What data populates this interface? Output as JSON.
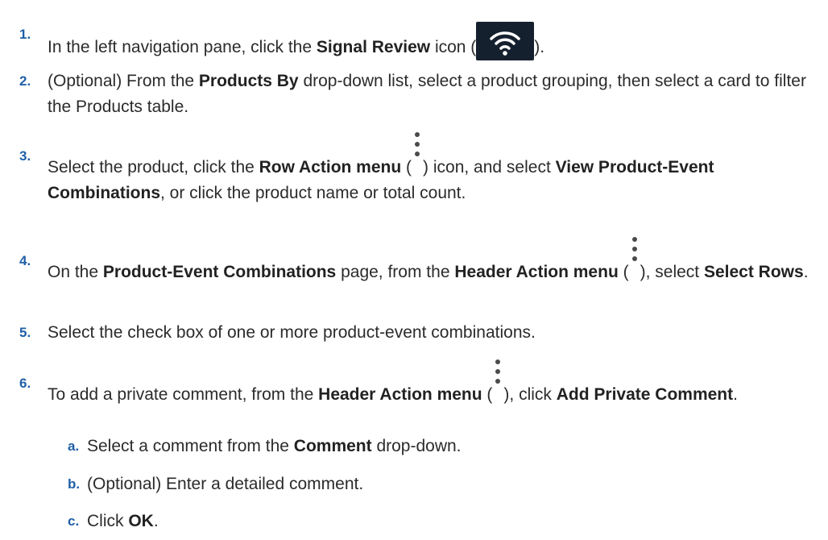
{
  "steps": [
    {
      "num": "1.",
      "parts": {
        "a": "In the left navigation pane, click the ",
        "b": "Signal Review",
        "c": " icon (",
        "d": ")."
      },
      "icon": "wifi-icon"
    },
    {
      "num": "2.",
      "parts": {
        "a": "(Optional) From the ",
        "b": "Products By",
        "c": " drop-down list, select a product grouping, then select a card to filter the Products table."
      }
    },
    {
      "num": "3.",
      "parts": {
        "a": "Select the product, click the ",
        "b": "Row Action menu",
        "c": " (",
        "d": ") icon, and select ",
        "e": "View Product-Event Combinations",
        "f": ", or click the product name or total count."
      },
      "icon": "kebab-menu-icon"
    },
    {
      "num": "4.",
      "parts": {
        "a": "On the ",
        "b": "Product-Event Combinations",
        "c": " page, from the ",
        "d": "Header Action menu",
        "e": " (",
        "f": "), select ",
        "g": "Select Rows",
        "h": "."
      },
      "icon": "kebab-menu-icon"
    },
    {
      "num": "5.",
      "parts": {
        "a": "Select the check box of one or more product-event combinations."
      }
    },
    {
      "num": "6.",
      "parts": {
        "a": "To add a private comment, from the ",
        "b": "Header Action menu",
        "c": " (",
        "d": "), click ",
        "e": "Add Private Comment",
        "f": "."
      },
      "icon": "kebab-menu-icon"
    }
  ],
  "substeps": [
    {
      "num": "a.",
      "a": "Select a comment from the ",
      "b": "Comment",
      "c": " drop-down."
    },
    {
      "num": "b.",
      "a": "(Optional) Enter a detailed comment."
    },
    {
      "num": "c.",
      "a": "Click ",
      "b": "OK",
      "c": "."
    }
  ]
}
